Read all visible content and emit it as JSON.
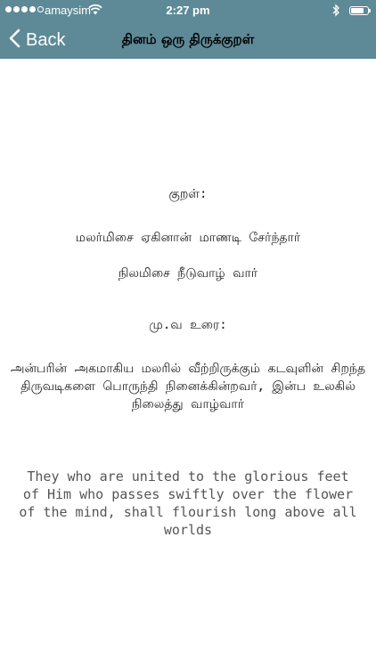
{
  "status_bar": {
    "carrier": "amaysim",
    "time": "2:27 pm",
    "icons": [
      "signal-dots",
      "wifi-icon",
      "bluetooth-icon",
      "battery-icon"
    ]
  },
  "nav": {
    "back_label": "Back",
    "title": "தினம் ஒரு திருக்குறள்"
  },
  "kural": {
    "heading": "குறள்:",
    "line1": "மலர்மிசை ஏகினான் மாணடி சேர்ந்தார்",
    "line2": "நிலமிசை நீடுவாழ் வார்"
  },
  "commentary": {
    "heading": "மு.வ உரை:",
    "text": "அன்பரின் அகமாகிய மலரில் வீற்றிருக்கும் கடவுளின் சிறந்த திருவடிகளை பொருந்தி நினைக்கின்றவர், இன்ப உலகில் நிலைத்து வாழ்வார்"
  },
  "translation": {
    "text": "They who are united to the glorious feet of Him who passes swiftly over the flower of the mind, shall flourish long above all worlds"
  },
  "colors": {
    "bar": "#5e8a97",
    "bar_text": "#ffffff",
    "title_text": "#000000",
    "english_text": "#555555"
  }
}
